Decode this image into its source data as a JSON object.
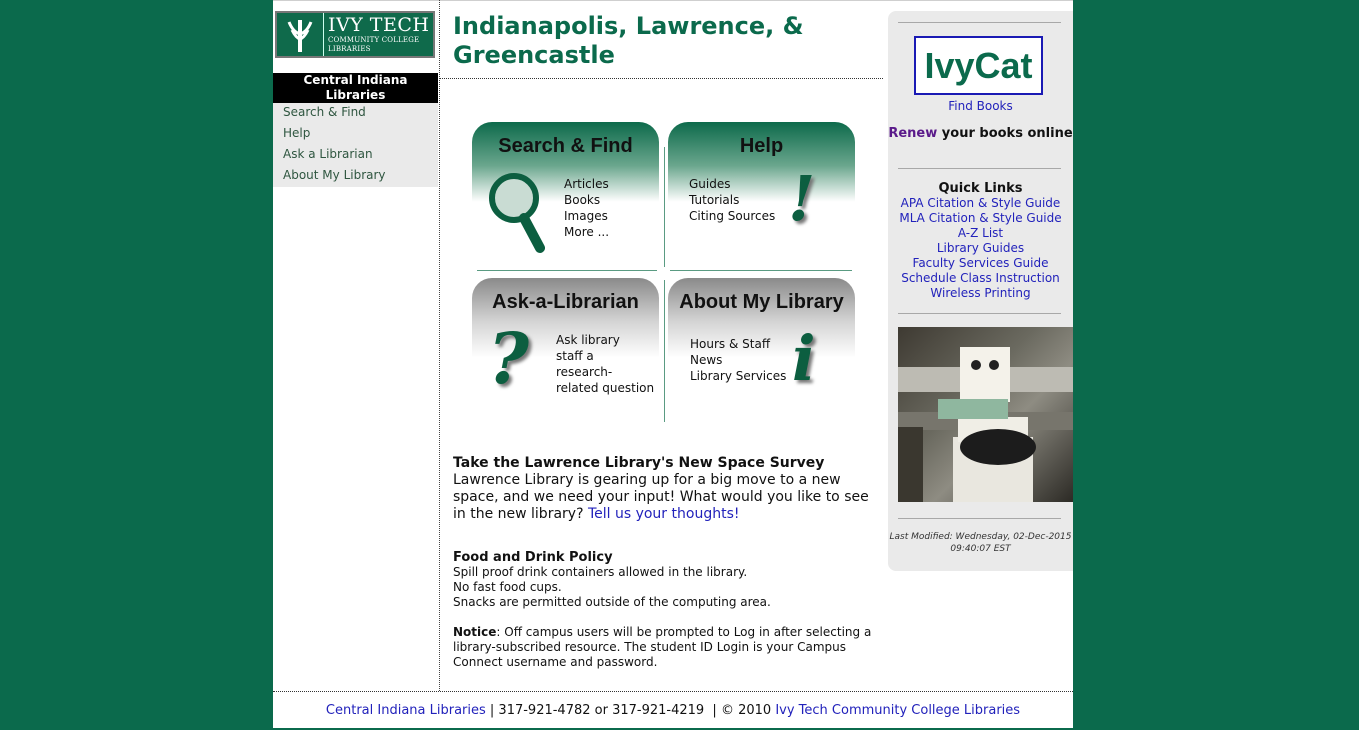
{
  "logo": {
    "line1": "IVY TECH",
    "line2": "COMMUNITY COLLEGE",
    "line3": "LIBRARIES"
  },
  "sidebar": {
    "heading": "Central Indiana Libraries",
    "items": [
      "Search & Find",
      "Help",
      "Ask a Librarian",
      "About My Library"
    ]
  },
  "main": {
    "title": "Indianapolis, Lawrence, & Greencastle",
    "panels": {
      "search": {
        "title": "Search & Find",
        "items": [
          "Articles",
          "Books",
          "Images",
          "More ..."
        ]
      },
      "help": {
        "title": "Help",
        "items": [
          "Guides",
          "Tutorials",
          "Citing Sources"
        ]
      },
      "ask": {
        "title": "Ask-a-Librarian",
        "items": [
          "Ask library",
          "staff a",
          "research-",
          "related question"
        ]
      },
      "about": {
        "title": "About My Library",
        "items": [
          "Hours & Staff",
          "News",
          "Library Services"
        ]
      }
    },
    "survey": {
      "title": "Take the Lawrence Library's New Space Survey",
      "body": "Lawrence Library is gearing up for a big move to a new space, and we need your input! What would you like to see in the new library?",
      "link": "Tell us your thoughts!"
    },
    "policy": {
      "title": "Food and Drink Policy",
      "lines": [
        "Spill proof drink containers allowed in the library.",
        "No fast food cups.",
        "Snacks are permitted outside of the computing area."
      ],
      "notice_label": "Notice",
      "notice_text": ": Off campus users will be prompted to Log in after selecting a library-subscribed resource. The student ID Login is your Campus Connect username and password."
    }
  },
  "right": {
    "ivycat": "IvyCat",
    "find_books": "Find Books",
    "renew_word": "Renew",
    "renew_rest": " your books online",
    "quick_links_title": "Quick Links",
    "quick_links": [
      "APA Citation & Style Guide",
      "MLA Citation & Style Guide",
      "A-Z List",
      "Library Guides",
      "Faculty Services  Guide",
      "Schedule Class Instruction",
      "Wireless Printing"
    ],
    "last_modified": "Last Modified: Wednesday, 02-Dec-2015 09:40:07 EST"
  },
  "footer": {
    "link1": "Central Indiana Libraries",
    "middle": " | 317-921-4782 or 317-921-4219  | © 2010 ",
    "link2": "Ivy Tech Community College Libraries"
  },
  "colors": {
    "brand_green": "#0b6a4c",
    "link_blue": "#2222bb",
    "renew_purple": "#5a1a8a"
  }
}
